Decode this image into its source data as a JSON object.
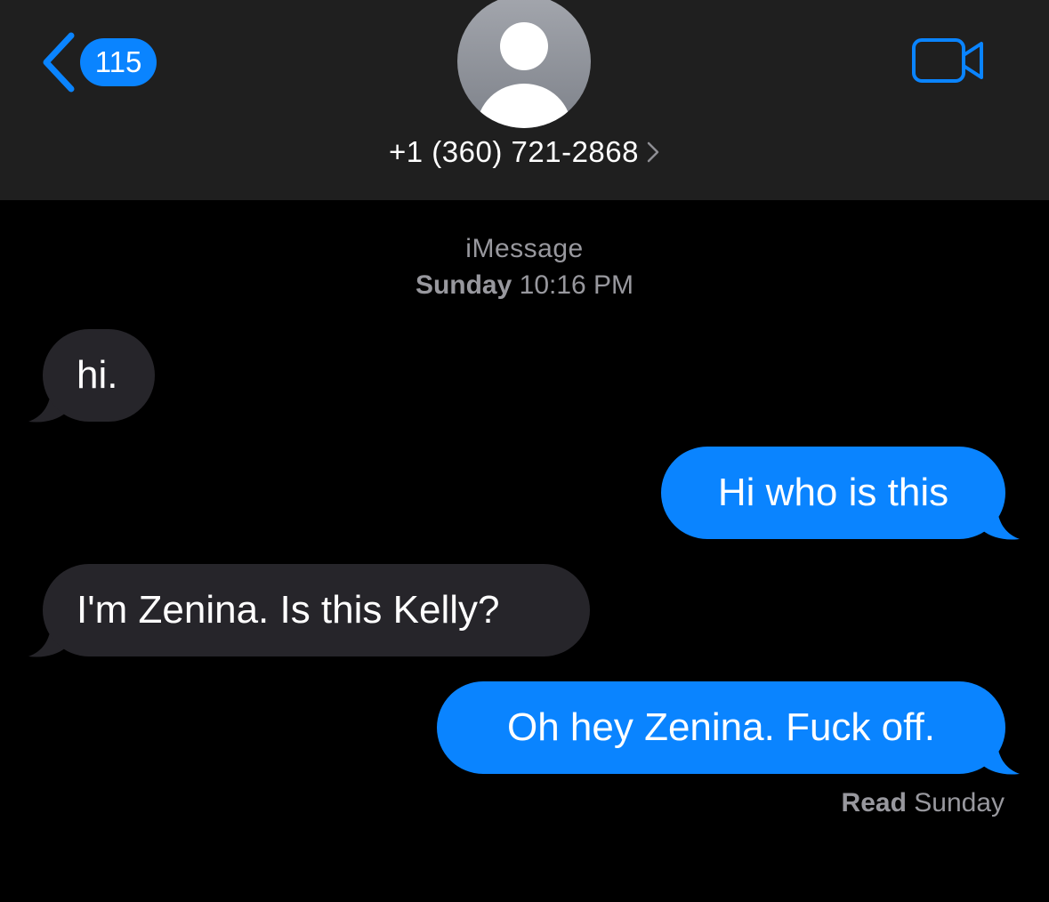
{
  "header": {
    "back_badge": "115",
    "contact": "+1 (360) 721-2868"
  },
  "conversation": {
    "service": "iMessage",
    "timestamp_day": "Sunday",
    "timestamp_time": "10:16 PM",
    "messages": [
      {
        "direction": "incoming",
        "text": "hi."
      },
      {
        "direction": "outgoing",
        "text": "Hi who is this"
      },
      {
        "direction": "incoming",
        "text": "I'm Zenina. Is this Kelly?"
      },
      {
        "direction": "outgoing",
        "text": "Oh hey Zenina. Fuck off."
      }
    ],
    "read_label": "Read",
    "read_day": "Sunday"
  },
  "colors": {
    "accent": "#0a84ff",
    "incoming_bubble": "#26252a",
    "header_bg": "#1f1f1f",
    "secondary_text": "#98989e"
  },
  "icons": [
    "back-chevron-icon",
    "contact-avatar-icon",
    "chevron-right-icon",
    "video-camera-icon"
  ]
}
